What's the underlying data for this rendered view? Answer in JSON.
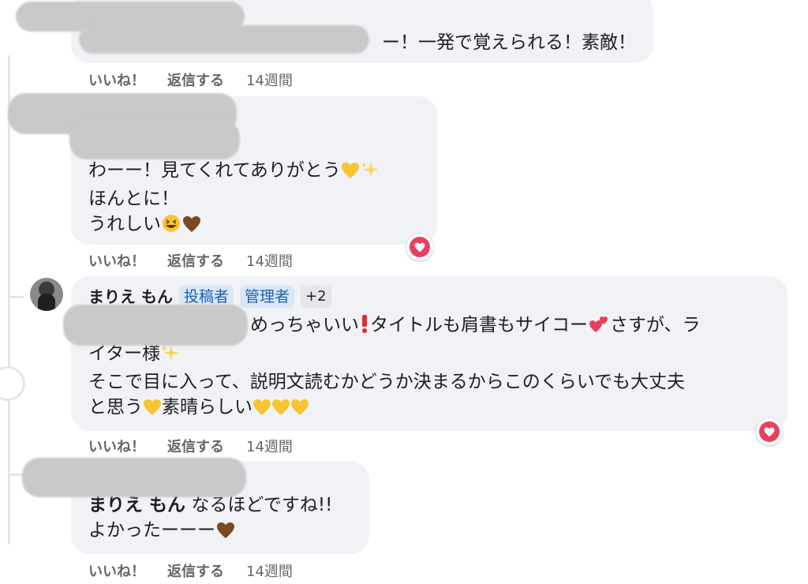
{
  "comments": [
    {
      "text_lines": [
        "ー！一発で覚えられる！素敵！"
      ],
      "actions": {
        "like": "いいね！",
        "reply": "返信する",
        "time": "14週間"
      }
    },
    {
      "text_lines": [
        "わーー！見てくれてありがとう",
        "ほんとに！",
        "うれしい"
      ],
      "actions": {
        "like": "いいね！",
        "reply": "返信する",
        "time": "14週間"
      },
      "reaction": "heart"
    },
    {
      "author": "まりえ もん",
      "tags": [
        "投稿者",
        "管理者",
        "+2"
      ],
      "text_lines": [
        "めっちゃいい",
        "タイトルも肩書もサイコー",
        "さすが、ラ",
        "イター様",
        "そこで目に入って、説明文読むかどうか決まるからこのくらいでも大丈夫",
        "と思う",
        "素晴らしい"
      ],
      "actions": {
        "like": "いいね！",
        "reply": "返信する",
        "time": "14週間"
      },
      "reaction": "heart"
    },
    {
      "mention": "まりえ もん",
      "text_lines": [
        "なるほどですね!!",
        "よかったーーー"
      ],
      "actions": {
        "like": "いいね！",
        "reply": "返信する",
        "time": "14週間"
      }
    }
  ],
  "colors": {
    "bubble": "#f0f2f5",
    "action_text": "#65676b",
    "tag_bg": "#dbe7f6",
    "tag_text": "#1a5fb4",
    "heart": "#e8405e"
  }
}
